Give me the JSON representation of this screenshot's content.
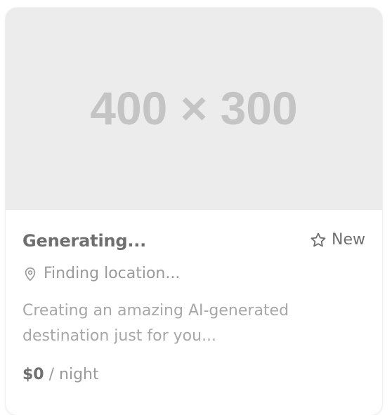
{
  "card": {
    "image_placeholder": "400 × 300",
    "title": "Generating...",
    "badge": {
      "icon": "star-outline-icon",
      "label": "New"
    },
    "location": {
      "icon": "map-pin-icon",
      "text": "Finding location..."
    },
    "description": "Creating an amazing AI-generated destination just for you...",
    "price": {
      "amount": "$0",
      "unit": "/ night"
    }
  },
  "colors": {
    "image_bg": "#ececec",
    "placeholder_text": "#c4c4c4",
    "title_text": "#6f6f6f",
    "secondary_text": "#9a9a9a"
  }
}
